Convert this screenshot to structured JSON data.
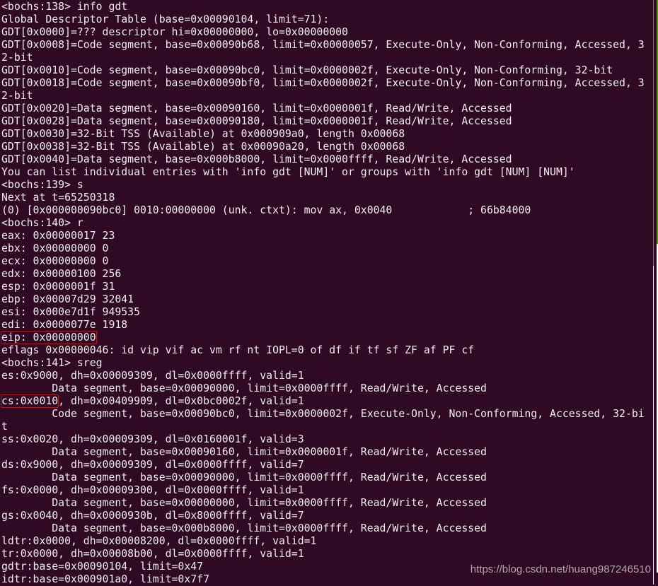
{
  "colors": {
    "background": "#300a24",
    "text": "#eeeeec",
    "highlight_box": "#b01c1c",
    "scrollbar_accent": "#4e9a06"
  },
  "terminal": {
    "lines": [
      "<bochs:138> info gdt",
      "Global Descriptor Table (base=0x00090104, limit=71):",
      "GDT[0x0000]=??? descriptor hi=0x00000000, lo=0x00000000",
      "GDT[0x0008]=Code segment, base=0x00090b68, limit=0x00000057, Execute-Only, Non-Conforming, Accessed, 3",
      "2-bit",
      "GDT[0x0010]=Code segment, base=0x00090bc0, limit=0x0000002f, Execute-Only, Non-Conforming, 32-bit",
      "GDT[0x0018]=Code segment, base=0x00090bf0, limit=0x0000002f, Execute-Only, Non-Conforming, Accessed, 3",
      "2-bit",
      "GDT[0x0020]=Data segment, base=0x00090160, limit=0x0000001f, Read/Write, Accessed",
      "GDT[0x0028]=Data segment, base=0x00090180, limit=0x0000001f, Read/Write, Accessed",
      "GDT[0x0030]=32-Bit TSS (Available) at 0x000909a0, length 0x00068",
      "GDT[0x0038]=32-Bit TSS (Available) at 0x00090a20, length 0x00068",
      "GDT[0x0040]=Data segment, base=0x000b8000, limit=0x0000ffff, Read/Write, Accessed",
      "You can list individual entries with 'info gdt [NUM]' or groups with 'info gdt [NUM] [NUM]'",
      "<bochs:139> s",
      "Next at t=65250318",
      "(0) [0x000000090bc0] 0010:00000000 (unk. ctxt): mov ax, 0x0040            ; 66b84000",
      "<bochs:140> r",
      "eax: 0x00000017 23",
      "ebx: 0x00000000 0",
      "ecx: 0x00000000 0",
      "edx: 0x00000100 256",
      "esp: 0x0000001f 31",
      "ebp: 0x00007d29 32041",
      "esi: 0x000e7d1f 949535",
      "edi: 0x0000077e 1918",
      {
        "boxed": "eip: 0x00000000",
        "rest": ""
      },
      "eflags 0x00000046: id vip vif ac vm rf nt IOPL=0 of df if tf sf ZF af PF cf",
      "<bochs:141> sreg",
      "es:0x9000, dh=0x00009309, dl=0x0000ffff, valid=1",
      "        Data segment, base=0x00090000, limit=0x0000ffff, Read/Write, Accessed",
      {
        "boxed": "cs:0x0010",
        "rest": ", dh=0x00409909, dl=0x0bc0002f, valid=1"
      },
      "        Code segment, base=0x00090bc0, limit=0x0000002f, Execute-Only, Non-Conforming, Accessed, 32-bi",
      "t",
      "ss:0x0020, dh=0x00009309, dl=0x0160001f, valid=3",
      "        Data segment, base=0x00090160, limit=0x0000001f, Read/Write, Accessed",
      "ds:0x9000, dh=0x00009309, dl=0x0000ffff, valid=7",
      "        Data segment, base=0x00090000, limit=0x0000ffff, Read/Write, Accessed",
      "fs:0x0000, dh=0x00009300, dl=0x0000ffff, valid=1",
      "        Data segment, base=0x00000000, limit=0x0000ffff, Read/Write, Accessed",
      "gs:0x0040, dh=0x0000930b, dl=0x8000ffff, valid=7",
      "        Data segment, base=0x000b8000, limit=0x0000ffff, Read/Write, Accessed",
      "ldtr:0x0000, dh=0x00008200, dl=0x0000ffff, valid=1",
      "tr:0x0000, dh=0x00008b00, dl=0x0000ffff, valid=1",
      "gdtr:base=0x00090104, limit=0x47",
      "idtr:base=0x000901a0, limit=0x7f7"
    ]
  },
  "watermark": "https://blog.csdn.net/huang987246510"
}
